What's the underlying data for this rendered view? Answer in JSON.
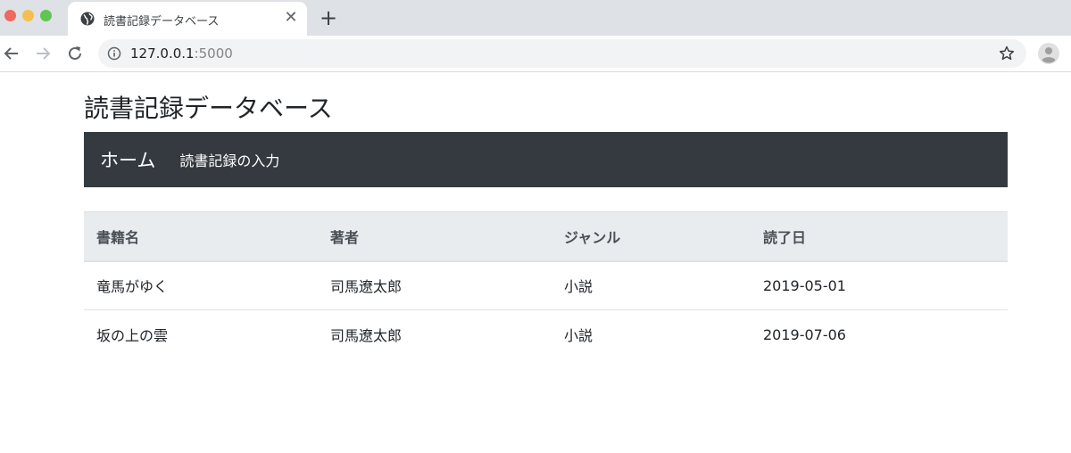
{
  "browser": {
    "tab_title": "読書記録データベース",
    "tab_close": "✕",
    "new_tab": "+",
    "url_host": "127.0.0.1",
    "url_port": ":5000"
  },
  "page": {
    "title": "読書記録データベース",
    "navbar": {
      "brand": "ホーム",
      "link": "読書記録の入力",
      "background": "#343a40"
    },
    "table": {
      "headers": [
        "書籍名",
        "著者",
        "ジャンル",
        "読了日"
      ],
      "rows": [
        [
          "竜馬がゆく",
          "司馬遼太郎",
          "小説",
          "2019-05-01"
        ],
        [
          "坂の上の雲",
          "司馬遼太郎",
          "小説",
          "2019-07-06"
        ]
      ]
    }
  }
}
